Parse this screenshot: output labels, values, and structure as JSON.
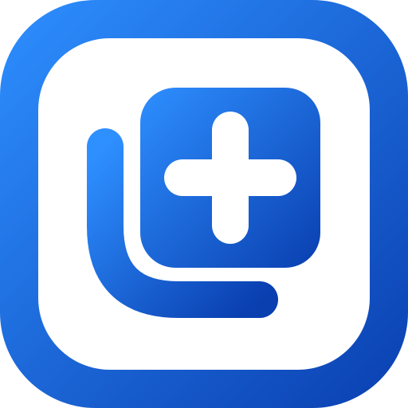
{
  "icon": {
    "name": "add-to-collection-icon",
    "description_colors": {
      "gradient_start": "#2E8FFF",
      "gradient_end": "#0A3FB0",
      "foreground": "#FFFFFF"
    }
  }
}
